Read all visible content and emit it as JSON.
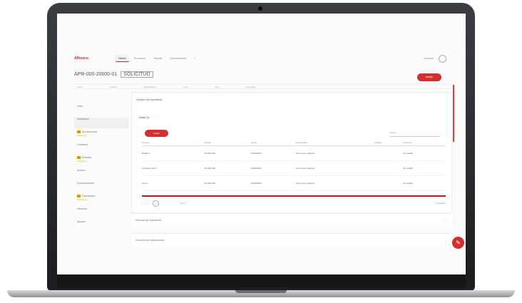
{
  "colors": {
    "accent": "#d32f2f",
    "sidebar_badge": "#c6a400"
  },
  "app": {
    "logo": "Alfresco",
    "nav": [
      "Home",
      "Procesos",
      "Tareas",
      "Documentos",
      "+"
    ],
    "user_label": "Usuario"
  },
  "page": {
    "title": "APR-000-20000-01",
    "title_ref": "SOLICITUD",
    "primary_button": "Acción"
  },
  "toolbar": [
    "Fecha",
    "Estado",
    "Responsable",
    "Área",
    "Tipo",
    "Resultado"
  ],
  "sidebar": [
    {
      "label": "",
      "sub": ""
    },
    {
      "label": "Inicio",
      "sub": ""
    },
    {
      "label": "Solicitudes",
      "sub": ""
    },
    {
      "label": "Aprobaciones",
      "sub": "Pendiente"
    },
    {
      "label": "Contratos",
      "sub": ""
    },
    {
      "label": "Revisión",
      "sub": "Pendiente"
    },
    {
      "label": "Archivo",
      "sub": ""
    },
    {
      "label": "Documentación",
      "sub": ""
    },
    {
      "label": "Facturación",
      "sub": "Pendiente"
    },
    {
      "label": "Informes",
      "sub": ""
    },
    {
      "label": "Ajustes",
      "sub": ""
    }
  ],
  "panel": {
    "header": "Detalles del expediente",
    "subtitle": "Lista",
    "subtitle_suffix": "(3)",
    "add_button": "Añadir",
    "search_placeholder": "Buscar",
    "columns": [
      "Nombre",
      "Código",
      "Fecha",
      "Descripción",
      "Estado",
      "Acciones"
    ],
    "rows": [
      [
        "Registro",
        "00-000-000",
        "00/00/0000",
        "Documento adjunto",
        "",
        "Ver detalle"
      ],
      [
        "Contrato marco",
        "00-000-000",
        "00/00/0000",
        "Documento adjunto",
        "",
        "Ver detalle"
      ],
      [
        "Anexo",
        "00-000-000",
        "00/00/0000",
        "Documento adjunto",
        "",
        "Ver detalle"
      ]
    ],
    "pager_current": "1",
    "pager_info": "1 de 3",
    "pager_total": "3 registros"
  },
  "sections": [
    {
      "label": "Historial del expediente"
    },
    {
      "label": "Documentos relacionados"
    }
  ],
  "fab_icon": "edit-icon"
}
